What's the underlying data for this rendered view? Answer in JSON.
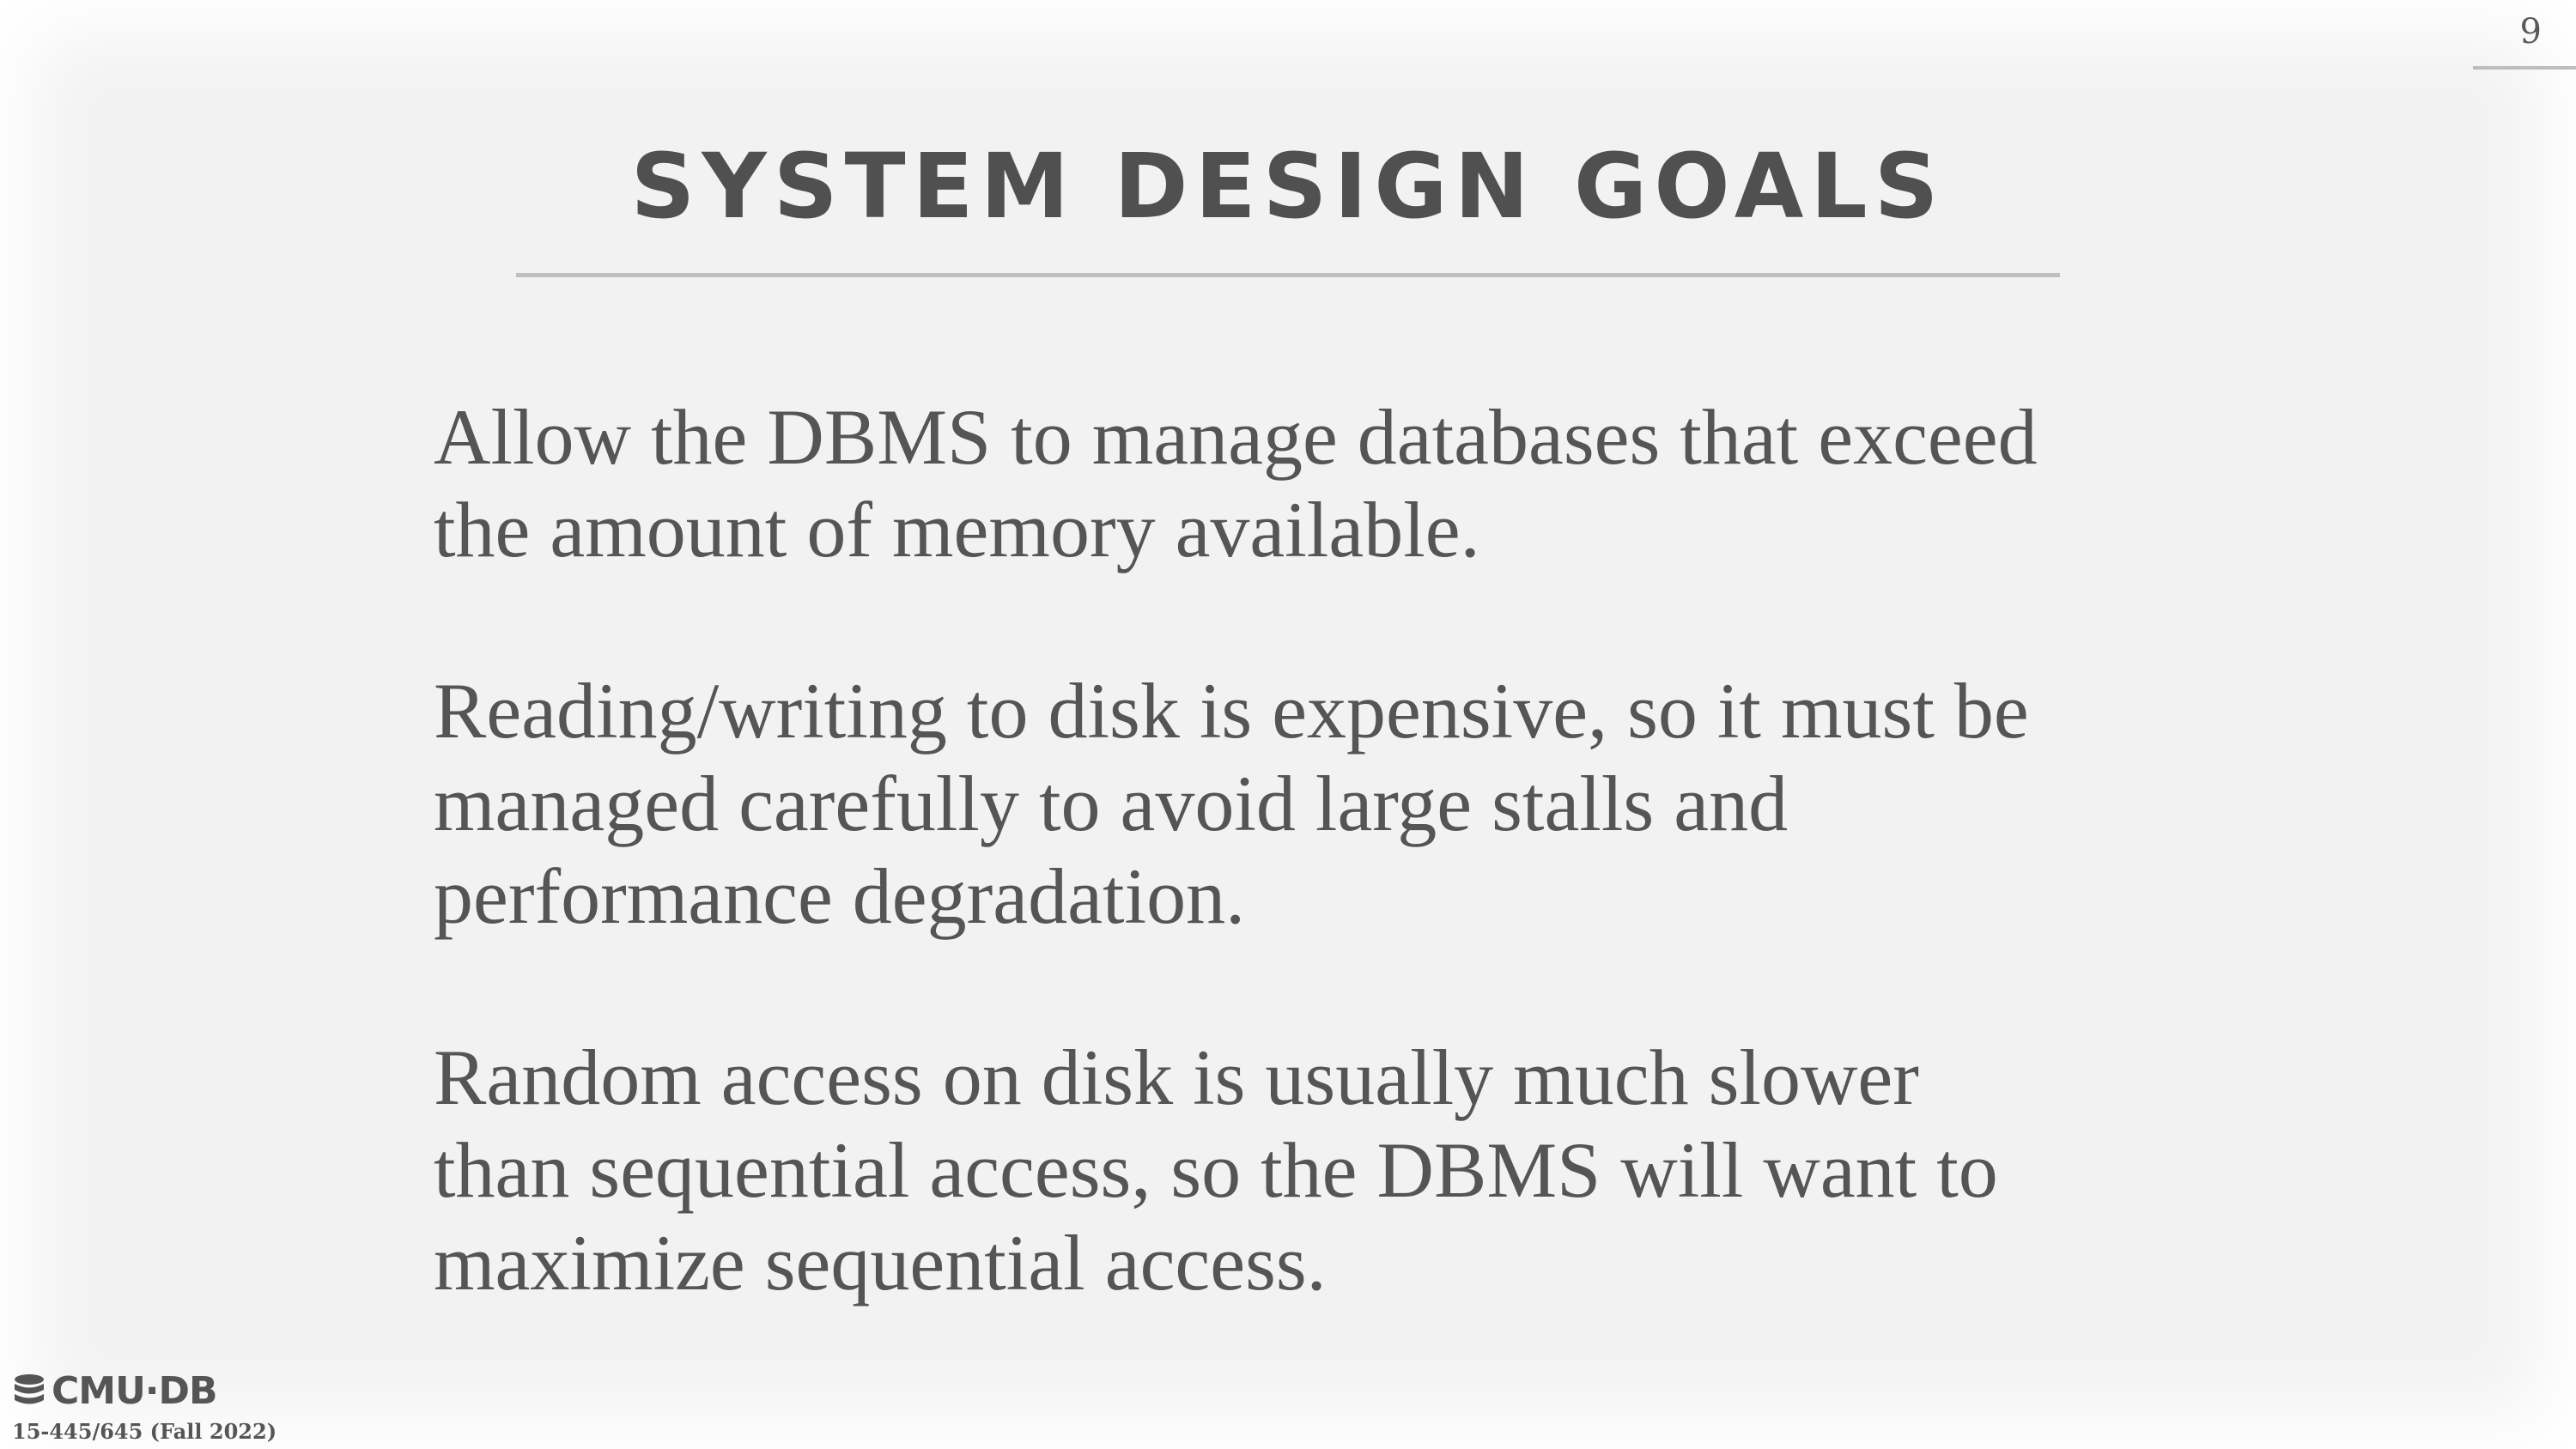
{
  "slide": {
    "page_number": "9",
    "title": "SYSTEM DESIGN GOALS",
    "paragraphs": [
      "Allow the DBMS to manage databases that exceed\nthe amount of memory available.",
      "Reading/writing to disk is expensive, so it must be\nmanaged carefully to avoid large stalls and\nperformance degradation.",
      "Random access on disk is usually much slower\nthan sequential access, so the DBMS will want to\nmaximize sequential access."
    ]
  },
  "footer": {
    "logo_text": "CMU·DB",
    "logo_icon": "database-icon",
    "course": "15-445/645 (Fall 2022)"
  },
  "colors": {
    "background": "#f2f2f2",
    "text": "#555555",
    "rule": "#bfbfbf"
  }
}
